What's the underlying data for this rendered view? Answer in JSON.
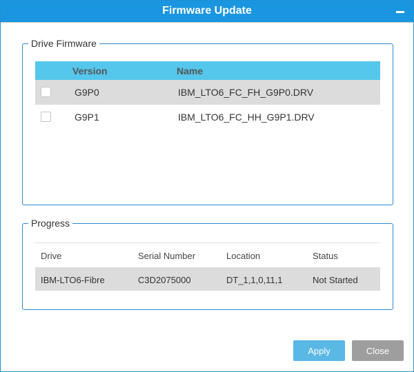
{
  "dialog": {
    "title": "Firmware Update"
  },
  "drive_firmware": {
    "legend": "Drive Firmware",
    "columns": {
      "version": "Version",
      "name": "Name"
    },
    "rows": [
      {
        "version": "G9P0",
        "name": "IBM_LTO6_FC_FH_G9P0.DRV",
        "checked": false
      },
      {
        "version": "G9P1",
        "name": "IBM_LTO6_FC_HH_G9P1.DRV",
        "checked": false
      }
    ]
  },
  "progress": {
    "legend": "Progress",
    "columns": {
      "drive": "Drive",
      "serial": "Serial Number",
      "location": "Location",
      "status": "Status"
    },
    "rows": [
      {
        "drive": "IBM-LTO6-Fibre",
        "serial": "C3D2075000",
        "location": "DT_1,1,0,11,1",
        "status": "Not Started"
      }
    ]
  },
  "buttons": {
    "apply": "Apply",
    "close": "Close"
  },
  "colors": {
    "titlebar": "#1a96e0",
    "table_header": "#55c6ec",
    "apply": "#5ab8e6",
    "close": "#9e9e9e"
  },
  "icons": {
    "minimize": "minimize-icon"
  }
}
